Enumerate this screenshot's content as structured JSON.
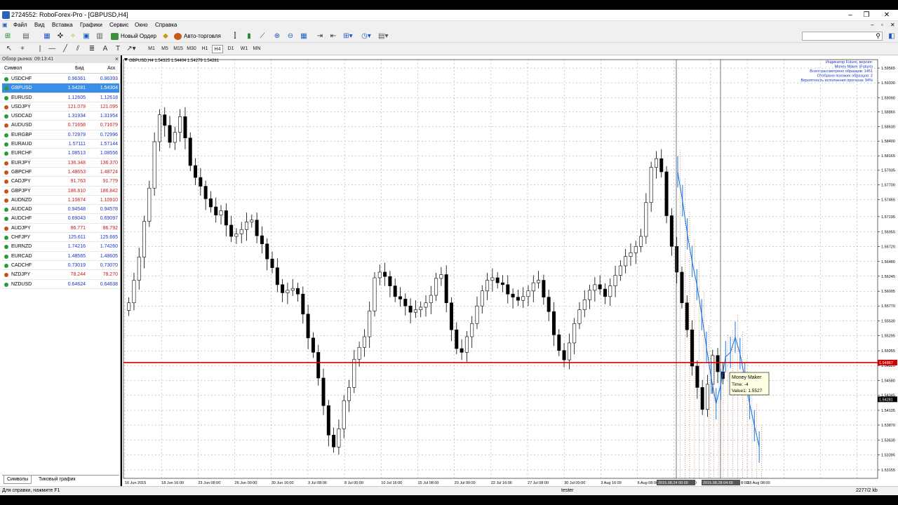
{
  "window": {
    "title": "2724552: RoboForex-Pro - [GBPUSD,H4]",
    "minimize": "–",
    "restore": "❐",
    "close": "✕"
  },
  "menu": [
    "Файл",
    "Вид",
    "Вставка",
    "Графики",
    "Сервис",
    "Окно",
    "Справка"
  ],
  "toolbar": {
    "new_order": "Новый Ордер",
    "auto_trading": "Авто-торговля",
    "timeframes": [
      "M1",
      "M5",
      "M15",
      "M30",
      "H1",
      "H4",
      "D1",
      "W1",
      "MN"
    ],
    "active_timeframe": "H4"
  },
  "market_watch": {
    "title": "Обзор рынка: 09:13:41",
    "columns": [
      "Символ",
      "Бид",
      "Аск"
    ],
    "selected": "GBPUSD",
    "rows": [
      {
        "symbol": "USDCHF",
        "bid": "0.96361",
        "ask": "0.96393",
        "color": "blue"
      },
      {
        "symbol": "GBPUSD",
        "bid": "1.54281",
        "ask": "1.54304",
        "color": "blue"
      },
      {
        "symbol": "EURUSD",
        "bid": "1.12605",
        "ask": "1.12618",
        "color": "blue"
      },
      {
        "symbol": "USDJPY",
        "bid": "121.079",
        "ask": "121.095",
        "color": "red"
      },
      {
        "symbol": "USDCAD",
        "bid": "1.31934",
        "ask": "1.31954",
        "color": "blue"
      },
      {
        "symbol": "AUDUSD",
        "bid": "0.71658",
        "ask": "0.71679",
        "color": "red"
      },
      {
        "symbol": "EURGBP",
        "bid": "0.72979",
        "ask": "0.72996",
        "color": "blue"
      },
      {
        "symbol": "EURAUD",
        "bid": "1.57111",
        "ask": "1.57144",
        "color": "blue"
      },
      {
        "symbol": "EURCHF",
        "bid": "1.08513",
        "ask": "1.08556",
        "color": "blue"
      },
      {
        "symbol": "EURJPY",
        "bid": "136.348",
        "ask": "136.370",
        "color": "red"
      },
      {
        "symbol": "GBPCHF",
        "bid": "1.48653",
        "ask": "1.48724",
        "color": "red"
      },
      {
        "symbol": "CADJPY",
        "bid": "91.763",
        "ask": "91.779",
        "color": "red"
      },
      {
        "symbol": "GBPJPY",
        "bid": "186.810",
        "ask": "186.842",
        "color": "red"
      },
      {
        "symbol": "AUDNZD",
        "bid": "1.10874",
        "ask": "1.10910",
        "color": "red"
      },
      {
        "symbol": "AUDCAD",
        "bid": "0.94548",
        "ask": "0.94578",
        "color": "blue"
      },
      {
        "symbol": "AUDCHF",
        "bid": "0.69043",
        "ask": "0.69097",
        "color": "blue"
      },
      {
        "symbol": "AUDJPY",
        "bid": "86.771",
        "ask": "86.792",
        "color": "red"
      },
      {
        "symbol": "CHFJPY",
        "bid": "125.611",
        "ask": "125.665",
        "color": "blue"
      },
      {
        "symbol": "EURNZD",
        "bid": "1.74216",
        "ask": "1.74260",
        "color": "blue"
      },
      {
        "symbol": "EURCAD",
        "bid": "1.48565",
        "ask": "1.48605",
        "color": "blue"
      },
      {
        "symbol": "CADCHF",
        "bid": "0.73019",
        "ask": "0.73070",
        "color": "blue"
      },
      {
        "symbol": "NZDJPY",
        "bid": "78.244",
        "ask": "78.270",
        "color": "red"
      },
      {
        "symbol": "NZDUSD",
        "bid": "0.64624",
        "ask": "0.64638",
        "color": "blue"
      }
    ],
    "tabs": [
      "Символы",
      "Тиковый график"
    ]
  },
  "chart_data": {
    "type": "candlestick",
    "symbol_info": "GBPUSD,H4  1.54325 1.54404 1.54279 1.54281",
    "indicator_lines": [
      "Индикатор Future, версия:",
      "Money Maker (Future)",
      "Всего рассмотрено образцов: 1451",
      "Отобрано похожих образцов: 2",
      "Вероятность исполнения прогноза: 94%"
    ],
    "y_ticks": [
      "1.59565",
      "1.59330",
      "1.59090",
      "1.58865",
      "1.58630",
      "1.58400",
      "1.58165",
      "1.57935",
      "1.57700",
      "1.57465",
      "1.57195",
      "1.56955",
      "1.56720",
      "1.56480",
      "1.56245",
      "1.56005",
      "1.55770",
      "1.55530",
      "1.55295",
      "1.55055",
      "1.54820",
      "1.54580",
      "1.54345",
      "1.54105",
      "1.53870",
      "1.53630",
      "1.53395",
      "1.53155"
    ],
    "ylim": [
      1.5302,
      1.597
    ],
    "x_ticks": [
      "16 Jun 2015",
      "18 Jun 16:00",
      "23 Jun 08:00",
      "26 Jun 00:00",
      "30 Jun 16:00",
      "3 Jul 08:00",
      "8 Jul 00:00",
      "10 Jul 16:00",
      "15 Jul 08:00",
      "20 Jul 00:00",
      "22 Jul 16:00",
      "27 Jul 08:00",
      "30 Jul 00:00",
      "3 Aug 16:00",
      "6 Aug 08:00",
      "11 Aug 00:00",
      "13 Aug 16:00",
      "18 Aug 08:00"
    ],
    "x_markers": [
      "2015.08.24 00:00",
      "2015.08.28 04:00"
    ],
    "x_tail": "8:00",
    "price_line": {
      "value": 1.54867,
      "label": "1.54867",
      "color": "#d40000"
    },
    "bid_label": "1.54281",
    "vertical_lines": 2,
    "candles_close": [
      1.5582,
      1.5618,
      1.5655,
      1.5712,
      1.5765,
      1.5839,
      1.5882,
      1.5865,
      1.5838,
      1.5854,
      1.5879,
      1.5845,
      1.5801,
      1.5782,
      1.5768,
      1.5748,
      1.5735,
      1.5722,
      1.5729,
      1.5706,
      1.5688,
      1.5692,
      1.5699,
      1.5711,
      1.5714,
      1.5689,
      1.5676,
      1.5652,
      1.5638,
      1.5611,
      1.5598,
      1.5602,
      1.5605,
      1.5596,
      1.5564,
      1.5526,
      1.5503,
      1.5462,
      1.5418,
      1.5371,
      1.5352,
      1.5381,
      1.5426,
      1.5447,
      1.5492,
      1.5511,
      1.5528,
      1.5569,
      1.5622,
      1.5631,
      1.5624,
      1.5609,
      1.5592,
      1.5588,
      1.5577,
      1.5567,
      1.5571,
      1.5575,
      1.5582,
      1.5594,
      1.5621,
      1.5627,
      1.5582,
      1.5539,
      1.5509,
      1.5503,
      1.5528,
      1.5549,
      1.5577,
      1.5601,
      1.5618,
      1.5622,
      1.5614,
      1.5611,
      1.5596,
      1.5591,
      1.5586,
      1.5592,
      1.5601,
      1.5614,
      1.5618,
      1.5591,
      1.5568,
      1.5531,
      1.5506,
      1.5491,
      1.5518,
      1.5549,
      1.5571,
      1.5587,
      1.5602,
      1.5611,
      1.5604,
      1.5592,
      1.5609,
      1.5626,
      1.5641,
      1.5656,
      1.5662,
      1.5672,
      1.5688,
      1.5742,
      1.5798,
      1.5812,
      1.5791,
      1.5721,
      1.5672,
      1.5631,
      1.5582,
      1.5539,
      1.5481,
      1.5447,
      1.5412,
      1.5452,
      1.5498,
      1.5472,
      1.5461
    ],
    "forecast": {
      "label": "Money Maker",
      "time_label": "Time: -4",
      "value_label": "Value1: 1.5527",
      "values": [
        1.5791,
        1.5745,
        1.5692,
        1.5648,
        1.5611,
        1.5563,
        1.5511,
        1.5462,
        1.5421,
        1.5452,
        1.5496,
        1.5503,
        1.5527,
        1.5501,
        1.5462,
        1.5421,
        1.5386,
        1.5352
      ]
    }
  },
  "status": {
    "help": "Для справки, нажмите F1",
    "profile": "tester",
    "traffic": "2277/2 kb"
  }
}
